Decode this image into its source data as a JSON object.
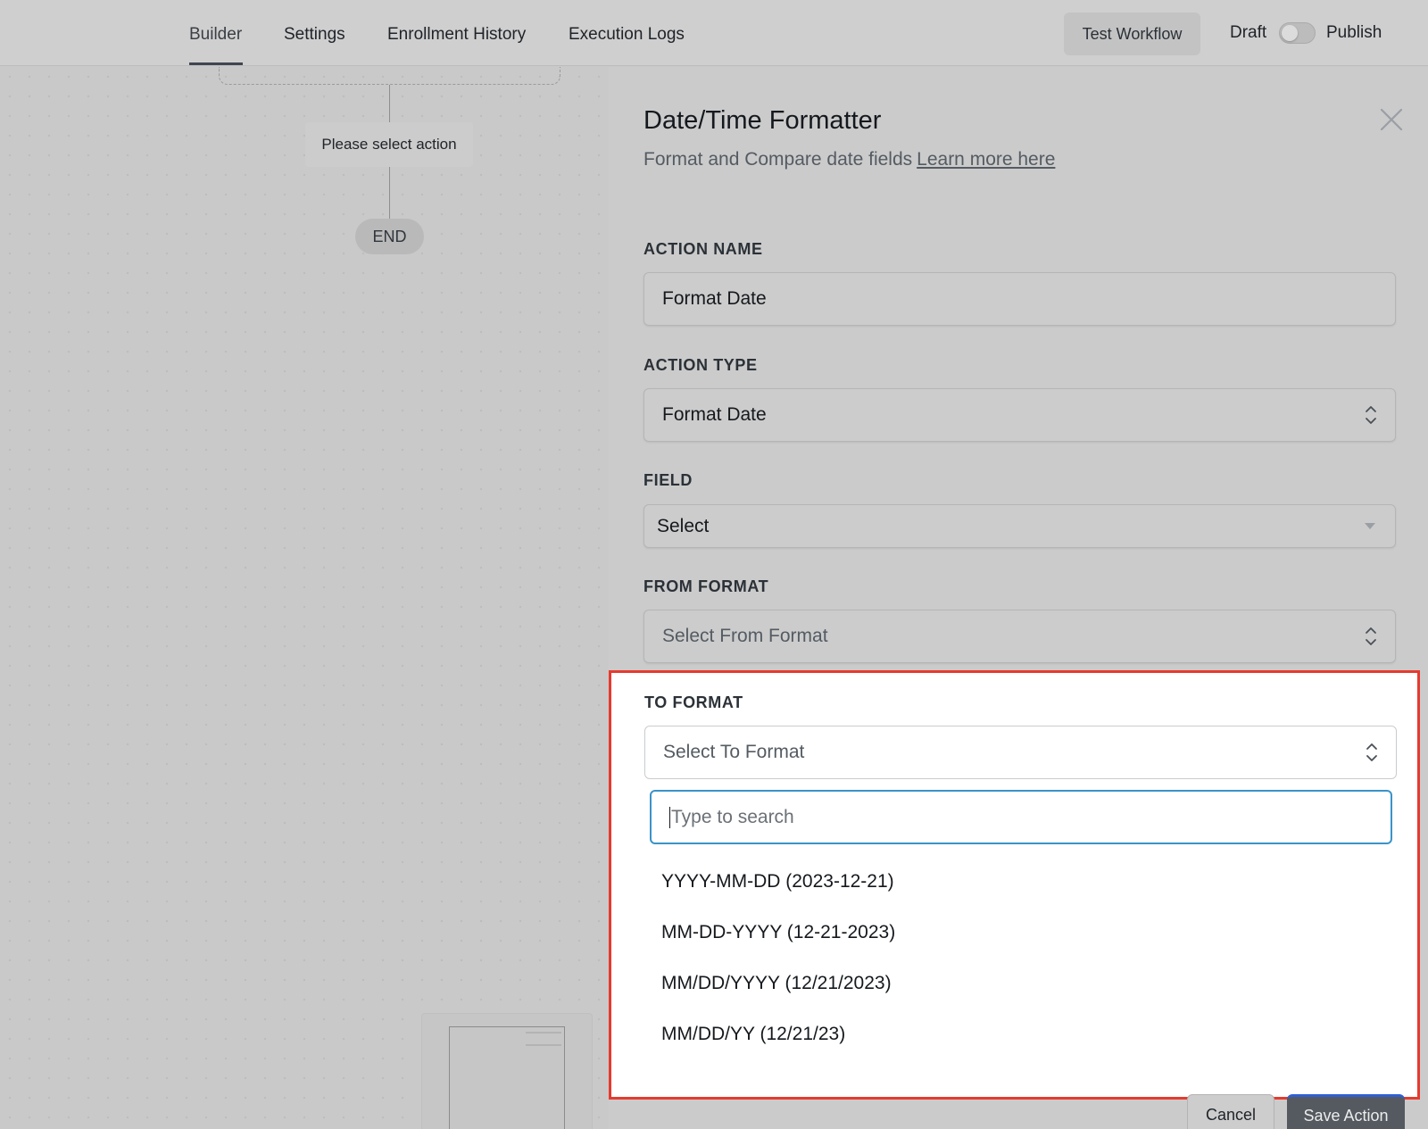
{
  "nav": {
    "tabs": [
      "Builder",
      "Settings",
      "Enrollment History",
      "Execution Logs"
    ],
    "active_tab": "Builder",
    "test_workflow": "Test Workflow",
    "draft": "Draft",
    "publish": "Publish"
  },
  "canvas": {
    "action_node": "Please select action",
    "end_node": "END"
  },
  "panel": {
    "title": "Date/Time Formatter",
    "subtitle": "Format and Compare date fields",
    "learn_more": "Learn more here",
    "action_name_label": "ACTION NAME",
    "action_name_value": "Format Date",
    "action_type_label": "ACTION TYPE",
    "action_type_value": "Format Date",
    "field_label": "FIELD",
    "field_value": "Select",
    "from_format_label": "FROM FORMAT",
    "from_format_placeholder": "Select From Format",
    "to_format_label": "TO FORMAT",
    "to_format_placeholder": "Select To Format",
    "search_placeholder": "Type to search",
    "options": [
      "YYYY-MM-DD (2023-12-21)",
      "MM-DD-YYYY (12-21-2023)",
      "MM/DD/YYYY (12/21/2023)",
      "MM/DD/YY (12/21/23)"
    ]
  },
  "footer": {
    "cancel": "Cancel",
    "save": "Save Action"
  },
  "colors": {
    "highlight_border": "#e63a2e",
    "search_focus": "#3a93c9",
    "save_accent": "#2f5fd8"
  }
}
